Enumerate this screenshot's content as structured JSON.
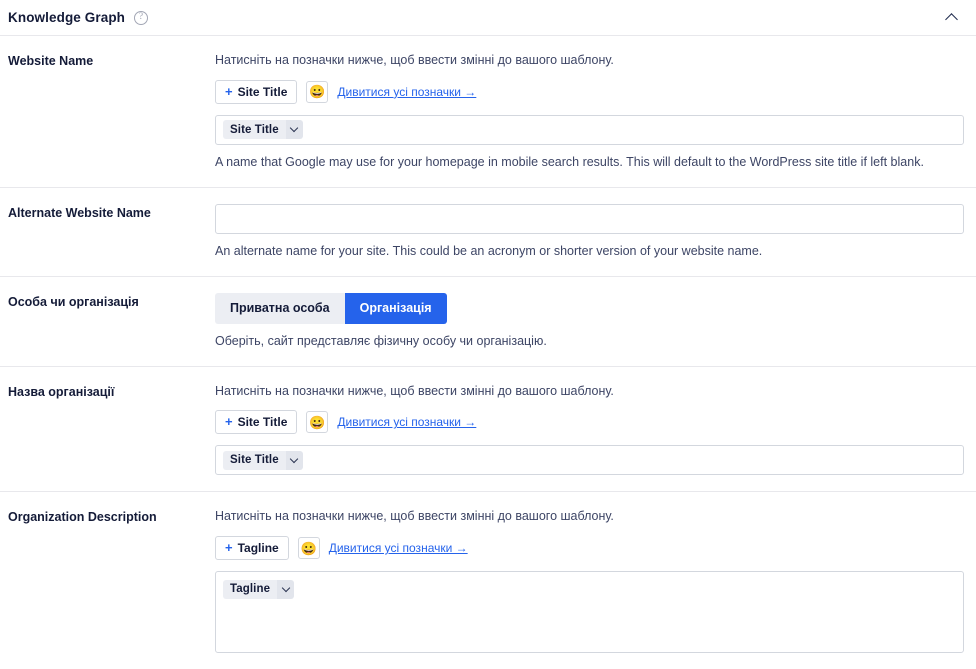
{
  "panel": {
    "title": "Knowledge Graph",
    "help_icon": "help-circle-icon",
    "collapse_icon": "chevron-up-icon"
  },
  "common": {
    "tag_hint": "Натисніть на позначки нижче, щоб ввести змінні до вашого шаблону.",
    "emoji": "😀",
    "all_tags_link": "Дивитися усі позначки →",
    "accent_color": "#2563eb",
    "chip_bg": "#eceef3",
    "border_color": "#d3d7de"
  },
  "rows": [
    {
      "id": "website-name",
      "label": "Website Name",
      "hint": "Натисніть на позначки нижче, щоб ввести змінні до вашого шаблону.",
      "add_tag_label": "Site Title",
      "link": "Дивитися усі позначки →",
      "chip": "Site Title",
      "value": "",
      "description": "A name that Google may use for your homepage in mobile search results. This will default to the WordPress site title if left blank."
    },
    {
      "id": "alternate-website-name",
      "label": "Alternate Website Name",
      "value": "",
      "placeholder": "",
      "description": "An alternate name for your site. This could be an acronym or shorter version of your website name."
    },
    {
      "id": "person-or-organization",
      "label": "Особа чи організація",
      "options": [
        {
          "label": "Приватна особа",
          "selected": false
        },
        {
          "label": "Організація",
          "selected": true
        }
      ],
      "description": "Оберіть, сайт представляє фізичну особу чи організацію."
    },
    {
      "id": "organization-name",
      "label": "Назва організації",
      "hint": "Натисніть на позначки нижче, щоб ввести змінні до вашого шаблону.",
      "add_tag_label": "Site Title",
      "link": "Дивитися усі позначки →",
      "chip": "Site Title",
      "value": ""
    },
    {
      "id": "organization-description",
      "label": "Organization Description",
      "hint": "Натисніть на позначки нижче, щоб ввести змінні до вашого шаблону.",
      "add_tag_label": "Tagline",
      "link": "Дивитися усі позначки →",
      "chip": "Tagline",
      "value": ""
    }
  ]
}
